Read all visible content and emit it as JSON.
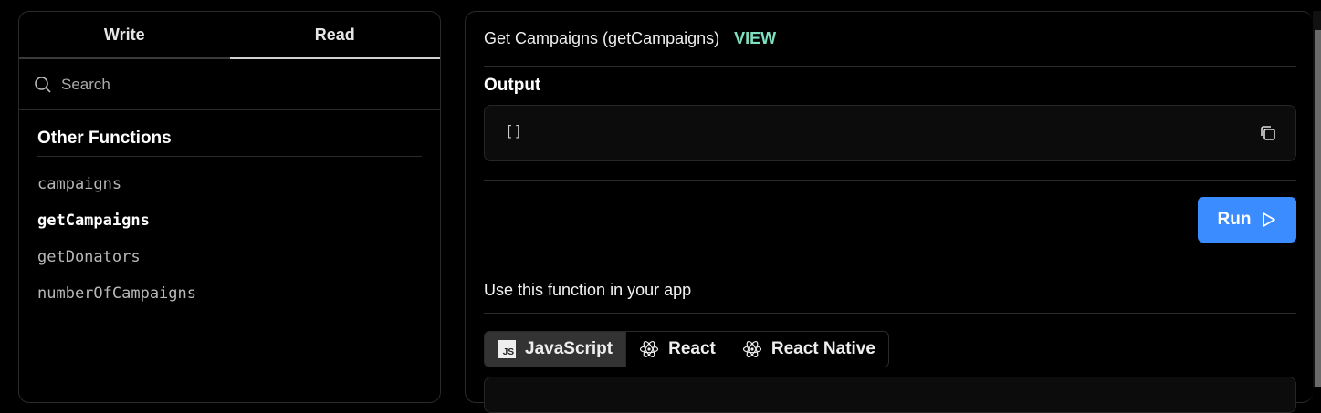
{
  "sidebar": {
    "tabs": [
      {
        "label": "Write"
      },
      {
        "label": "Read",
        "active": true
      }
    ],
    "search_placeholder": "Search",
    "section_title": "Other Functions",
    "items": [
      {
        "label": "campaigns"
      },
      {
        "label": "getCampaigns",
        "active": true
      },
      {
        "label": "getDonators"
      },
      {
        "label": "numberOfCampaigns"
      }
    ]
  },
  "main": {
    "title": "Get Campaigns (getCampaigns)",
    "badge": "VIEW",
    "output_label": "Output",
    "output_value": "[]",
    "run_label": "Run",
    "use_label": "Use this function in your app",
    "lang_tabs": [
      {
        "label": "JavaScript",
        "icon": "js-icon",
        "active": true
      },
      {
        "label": "React",
        "icon": "react-icon"
      },
      {
        "label": "React Native",
        "icon": "react-icon"
      }
    ]
  },
  "colors": {
    "accent": "#3b8cff",
    "badge": "#7ee0c0"
  }
}
